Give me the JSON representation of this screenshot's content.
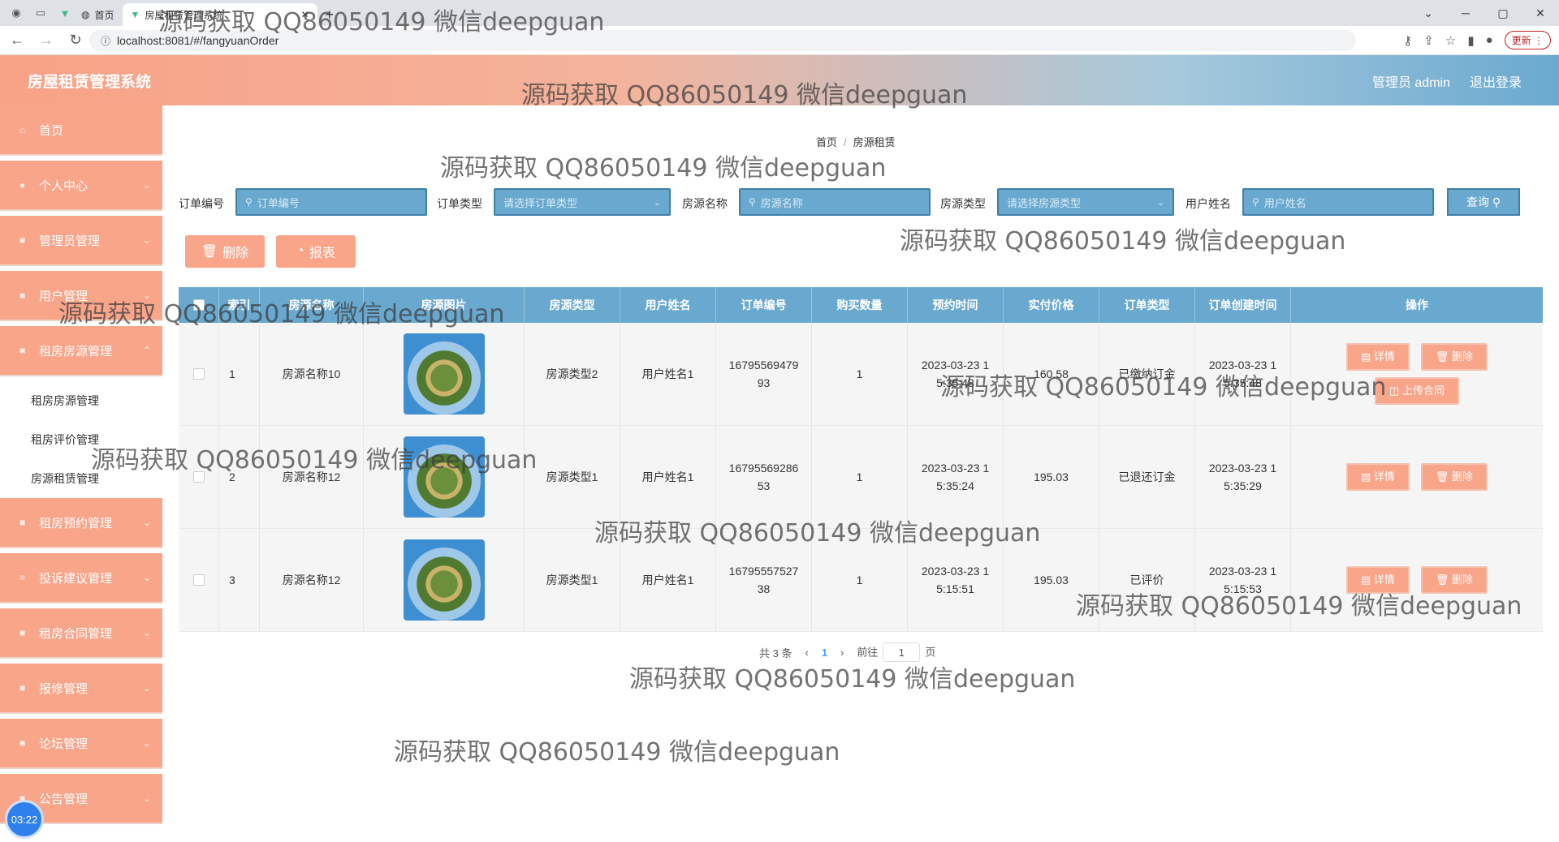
{
  "browser": {
    "tab_home_label": "首页",
    "tab_active_label": "房屋租赁管理系统",
    "new_tab": "+",
    "url": "localhost:8081/#/fangyuanOrder",
    "update_label": "更新"
  },
  "app": {
    "title": "房屋租赁管理系统",
    "admin_label": "管理员 admin",
    "logout_label": "退出登录"
  },
  "sidebar": {
    "items": [
      {
        "label": "首页"
      },
      {
        "label": "个人中心"
      },
      {
        "label": "管理员管理"
      },
      {
        "label": "用户管理"
      },
      {
        "label": "租房房源管理"
      }
    ],
    "submenu": [
      "租房房源管理",
      "租房评价管理",
      "房源租赁管理"
    ],
    "items_after": [
      {
        "label": "租房预约管理"
      },
      {
        "label": "投诉建议管理"
      },
      {
        "label": "租房合同管理"
      },
      {
        "label": "报修管理"
      },
      {
        "label": "论坛管理"
      },
      {
        "label": "公告管理"
      }
    ],
    "clock": "03:22"
  },
  "breadcrumb": {
    "home": "首页",
    "sep": "/",
    "current": "房源租赁"
  },
  "filters": {
    "order_no_label": "订单编号",
    "order_no_placeholder": "订单编号",
    "order_type_label": "订单类型",
    "order_type_placeholder": "请选择订单类型",
    "house_name_label": "房源名称",
    "house_name_placeholder": "房源名称",
    "house_type_label": "房源类型",
    "house_type_placeholder": "请选择房源类型",
    "user_name_label": "用户姓名",
    "user_name_placeholder": "用户姓名",
    "query_label": "查询"
  },
  "actions": {
    "delete_label": "删除",
    "report_label": "报表"
  },
  "table": {
    "headers": [
      "索引",
      "房源名称",
      "房源图片",
      "房源类型",
      "用户姓名",
      "订单编号",
      "购买数量",
      "预约时间",
      "实付价格",
      "订单类型",
      "订单创建时间",
      "操作"
    ],
    "rows": [
      {
        "index": "1",
        "house_name": "房源名称10",
        "house_type": "房源类型2",
        "user_name": "用户姓名1",
        "order_no": "16795569479 93",
        "qty": "1",
        "reserve_time": "2023-03-23 1 5:35:48",
        "price": "160.58",
        "order_type": "已缴纳订金",
        "create_time": "2023-03-23 1 5:35:48",
        "upload": true
      },
      {
        "index": "2",
        "house_name": "房源名称12",
        "house_type": "房源类型1",
        "user_name": "用户姓名1",
        "order_no": "16795569286 53",
        "qty": "1",
        "reserve_time": "2023-03-23 1 5:35:24",
        "price": "195.03",
        "order_type": "已退还订金",
        "create_time": "2023-03-23 1 5:35:29",
        "upload": false
      },
      {
        "index": "3",
        "house_name": "房源名称12",
        "house_type": "房源类型1",
        "user_name": "用户姓名1",
        "order_no": "16795557527 38",
        "qty": "1",
        "reserve_time": "2023-03-23 1 5:15:51",
        "price": "195.03",
        "order_type": "已评价",
        "create_time": "2023-03-23 1 5:15:53",
        "upload": false
      }
    ],
    "detail_label": "详情",
    "row_delete_label": "删除",
    "upload_label": "上传合同"
  },
  "pager": {
    "total": "共 3 条",
    "page": "1",
    "goto": "前往",
    "goto_value": "1",
    "page_unit": "页"
  },
  "watermark": "源码获取 QQ86050149 微信deepguan"
}
